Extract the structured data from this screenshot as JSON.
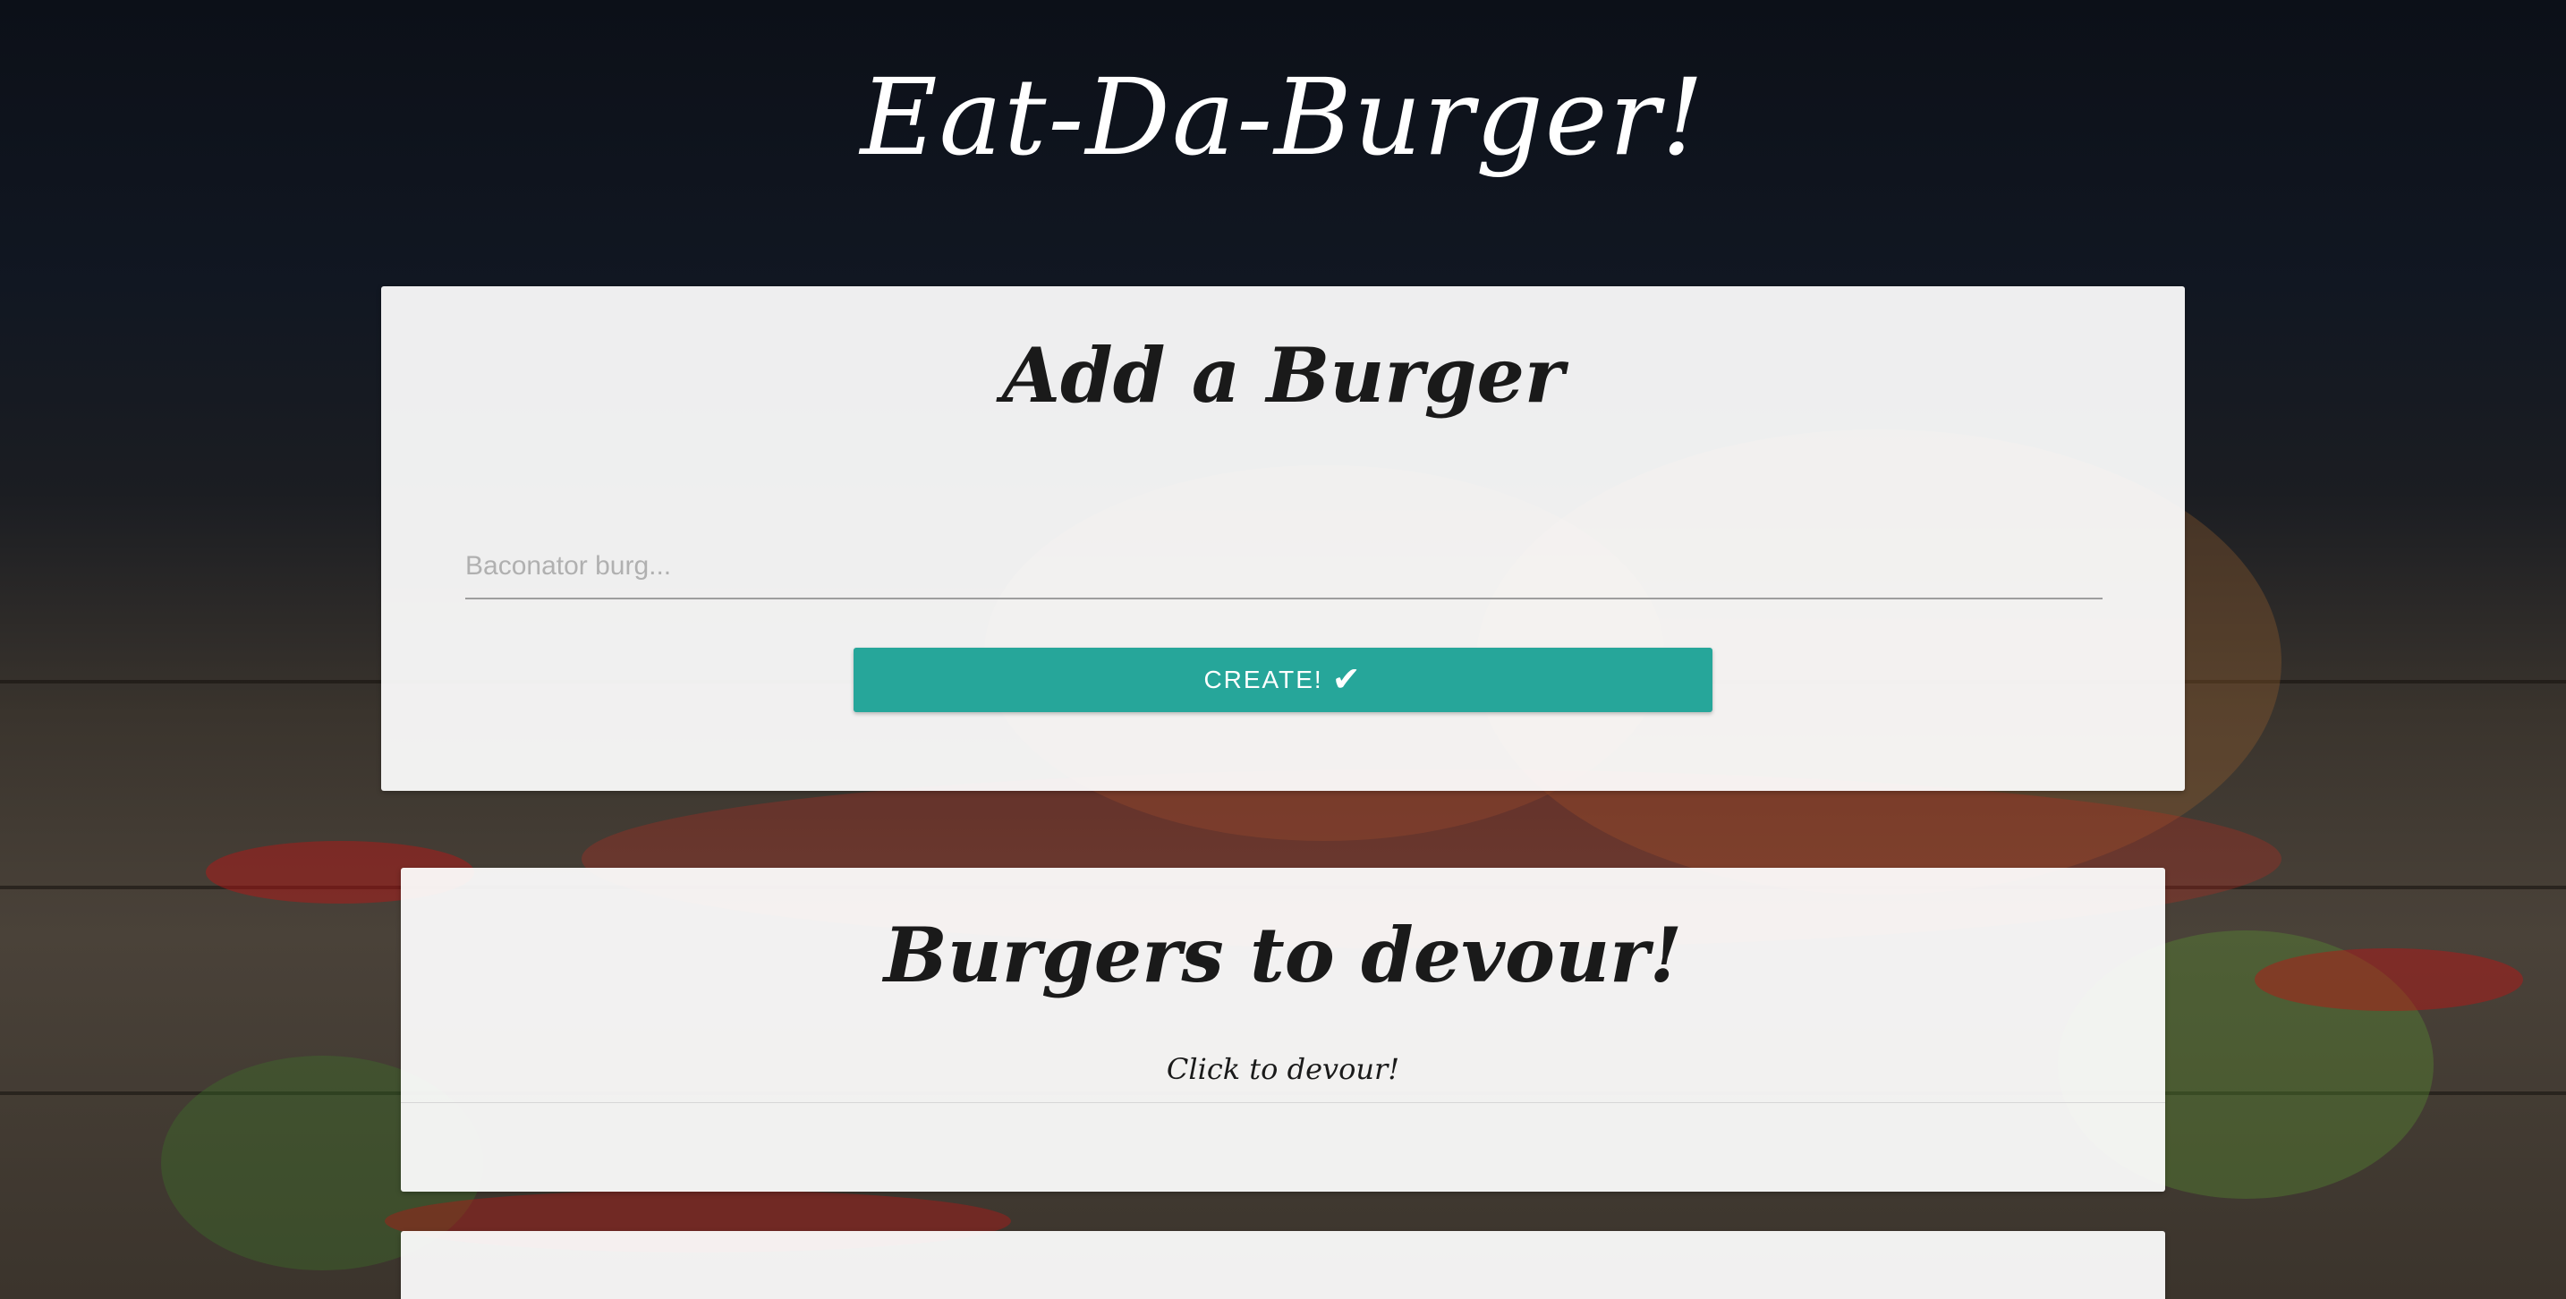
{
  "page": {
    "title": "Eat-Da-Burger!"
  },
  "add_burger": {
    "heading": "Add a Burger",
    "input_placeholder": "Baconator burg...",
    "input_value": "",
    "create_label": "CREATE!",
    "create_icon": "check-icon"
  },
  "devour": {
    "heading": "Burgers to devour!",
    "hint": "Click to devour!",
    "items": []
  },
  "colors": {
    "accent": "#26a69a",
    "card_background": "#f4f4f4",
    "title_text": "#ffffff"
  }
}
